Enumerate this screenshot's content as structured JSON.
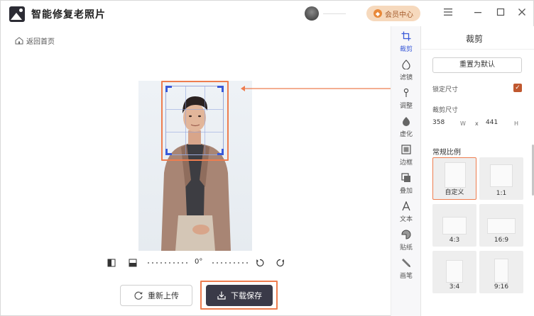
{
  "app": {
    "title": "智能修复老照片"
  },
  "header": {
    "vip_label": "会员中心"
  },
  "nav": {
    "back_label": "返回首页"
  },
  "editor": {
    "rotation_label": "0°"
  },
  "actions": {
    "reupload_label": "重新上传",
    "download_label": "下载保存"
  },
  "tools": [
    {
      "label": "裁剪",
      "icon": "crop-icon",
      "active": true
    },
    {
      "label": "滤镜",
      "icon": "filter-icon"
    },
    {
      "label": "调整",
      "icon": "adjust-icon"
    },
    {
      "label": "虚化",
      "icon": "blur-icon"
    },
    {
      "label": "边框",
      "icon": "frame-icon"
    },
    {
      "label": "叠加",
      "icon": "overlay-icon"
    },
    {
      "label": "文本",
      "icon": "text-icon"
    },
    {
      "label": "贴纸",
      "icon": "sticker-icon"
    },
    {
      "label": "画笔",
      "icon": "brush-icon"
    }
  ],
  "panel": {
    "title": "裁剪",
    "reset_label": "重置为默认",
    "lock_label": "锁定尺寸",
    "lock_checked": true,
    "size_label": "裁剪尺寸",
    "width": "358",
    "width_unit": "W",
    "times": "x",
    "height": "441",
    "height_unit": "H",
    "ratio_title": "常规比例",
    "ratios": [
      {
        "label": "自定义",
        "selected": true
      },
      {
        "label": "1:1"
      },
      {
        "label": "4:3"
      },
      {
        "label": "16:9"
      },
      {
        "label": "3:4"
      },
      {
        "label": "9:16"
      }
    ]
  },
  "colors": {
    "accent": "#ee7d4f",
    "crop_handle": "#3a5ad8",
    "dark_button": "#3a3a48",
    "vip_bg": "#f6d9bd"
  }
}
